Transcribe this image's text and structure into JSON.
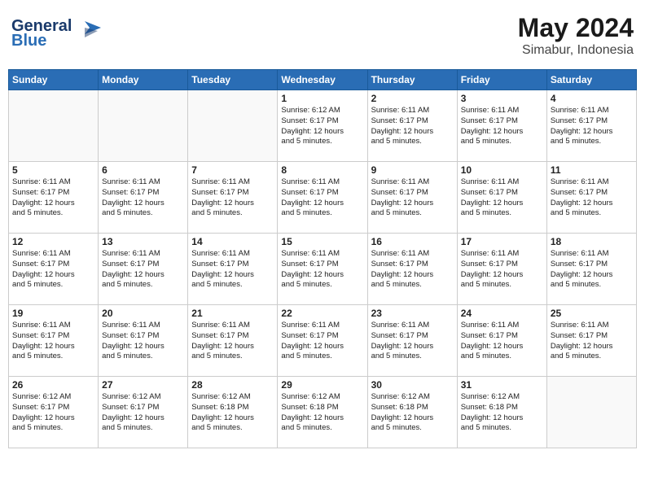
{
  "logo": {
    "text_general": "General",
    "text_blue": "Blue"
  },
  "header": {
    "month": "May 2024",
    "location": "Simabur, Indonesia"
  },
  "weekdays": [
    "Sunday",
    "Monday",
    "Tuesday",
    "Wednesday",
    "Thursday",
    "Friday",
    "Saturday"
  ],
  "weeks": [
    [
      {
        "day": "",
        "content": ""
      },
      {
        "day": "",
        "content": ""
      },
      {
        "day": "",
        "content": ""
      },
      {
        "day": "1",
        "content": "Sunrise: 6:12 AM\nSunset: 6:17 PM\nDaylight: 12 hours\nand 5 minutes."
      },
      {
        "day": "2",
        "content": "Sunrise: 6:11 AM\nSunset: 6:17 PM\nDaylight: 12 hours\nand 5 minutes."
      },
      {
        "day": "3",
        "content": "Sunrise: 6:11 AM\nSunset: 6:17 PM\nDaylight: 12 hours\nand 5 minutes."
      },
      {
        "day": "4",
        "content": "Sunrise: 6:11 AM\nSunset: 6:17 PM\nDaylight: 12 hours\nand 5 minutes."
      }
    ],
    [
      {
        "day": "5",
        "content": "Sunrise: 6:11 AM\nSunset: 6:17 PM\nDaylight: 12 hours\nand 5 minutes."
      },
      {
        "day": "6",
        "content": "Sunrise: 6:11 AM\nSunset: 6:17 PM\nDaylight: 12 hours\nand 5 minutes."
      },
      {
        "day": "7",
        "content": "Sunrise: 6:11 AM\nSunset: 6:17 PM\nDaylight: 12 hours\nand 5 minutes."
      },
      {
        "day": "8",
        "content": "Sunrise: 6:11 AM\nSunset: 6:17 PM\nDaylight: 12 hours\nand 5 minutes."
      },
      {
        "day": "9",
        "content": "Sunrise: 6:11 AM\nSunset: 6:17 PM\nDaylight: 12 hours\nand 5 minutes."
      },
      {
        "day": "10",
        "content": "Sunrise: 6:11 AM\nSunset: 6:17 PM\nDaylight: 12 hours\nand 5 minutes."
      },
      {
        "day": "11",
        "content": "Sunrise: 6:11 AM\nSunset: 6:17 PM\nDaylight: 12 hours\nand 5 minutes."
      }
    ],
    [
      {
        "day": "12",
        "content": "Sunrise: 6:11 AM\nSunset: 6:17 PM\nDaylight: 12 hours\nand 5 minutes."
      },
      {
        "day": "13",
        "content": "Sunrise: 6:11 AM\nSunset: 6:17 PM\nDaylight: 12 hours\nand 5 minutes."
      },
      {
        "day": "14",
        "content": "Sunrise: 6:11 AM\nSunset: 6:17 PM\nDaylight: 12 hours\nand 5 minutes."
      },
      {
        "day": "15",
        "content": "Sunrise: 6:11 AM\nSunset: 6:17 PM\nDaylight: 12 hours\nand 5 minutes."
      },
      {
        "day": "16",
        "content": "Sunrise: 6:11 AM\nSunset: 6:17 PM\nDaylight: 12 hours\nand 5 minutes."
      },
      {
        "day": "17",
        "content": "Sunrise: 6:11 AM\nSunset: 6:17 PM\nDaylight: 12 hours\nand 5 minutes."
      },
      {
        "day": "18",
        "content": "Sunrise: 6:11 AM\nSunset: 6:17 PM\nDaylight: 12 hours\nand 5 minutes."
      }
    ],
    [
      {
        "day": "19",
        "content": "Sunrise: 6:11 AM\nSunset: 6:17 PM\nDaylight: 12 hours\nand 5 minutes."
      },
      {
        "day": "20",
        "content": "Sunrise: 6:11 AM\nSunset: 6:17 PM\nDaylight: 12 hours\nand 5 minutes."
      },
      {
        "day": "21",
        "content": "Sunrise: 6:11 AM\nSunset: 6:17 PM\nDaylight: 12 hours\nand 5 minutes."
      },
      {
        "day": "22",
        "content": "Sunrise: 6:11 AM\nSunset: 6:17 PM\nDaylight: 12 hours\nand 5 minutes."
      },
      {
        "day": "23",
        "content": "Sunrise: 6:11 AM\nSunset: 6:17 PM\nDaylight: 12 hours\nand 5 minutes."
      },
      {
        "day": "24",
        "content": "Sunrise: 6:11 AM\nSunset: 6:17 PM\nDaylight: 12 hours\nand 5 minutes."
      },
      {
        "day": "25",
        "content": "Sunrise: 6:11 AM\nSunset: 6:17 PM\nDaylight: 12 hours\nand 5 minutes."
      }
    ],
    [
      {
        "day": "26",
        "content": "Sunrise: 6:12 AM\nSunset: 6:17 PM\nDaylight: 12 hours\nand 5 minutes."
      },
      {
        "day": "27",
        "content": "Sunrise: 6:12 AM\nSunset: 6:17 PM\nDaylight: 12 hours\nand 5 minutes."
      },
      {
        "day": "28",
        "content": "Sunrise: 6:12 AM\nSunset: 6:18 PM\nDaylight: 12 hours\nand 5 minutes."
      },
      {
        "day": "29",
        "content": "Sunrise: 6:12 AM\nSunset: 6:18 PM\nDaylight: 12 hours\nand 5 minutes."
      },
      {
        "day": "30",
        "content": "Sunrise: 6:12 AM\nSunset: 6:18 PM\nDaylight: 12 hours\nand 5 minutes."
      },
      {
        "day": "31",
        "content": "Sunrise: 6:12 AM\nSunset: 6:18 PM\nDaylight: 12 hours\nand 5 minutes."
      },
      {
        "day": "",
        "content": ""
      }
    ]
  ]
}
